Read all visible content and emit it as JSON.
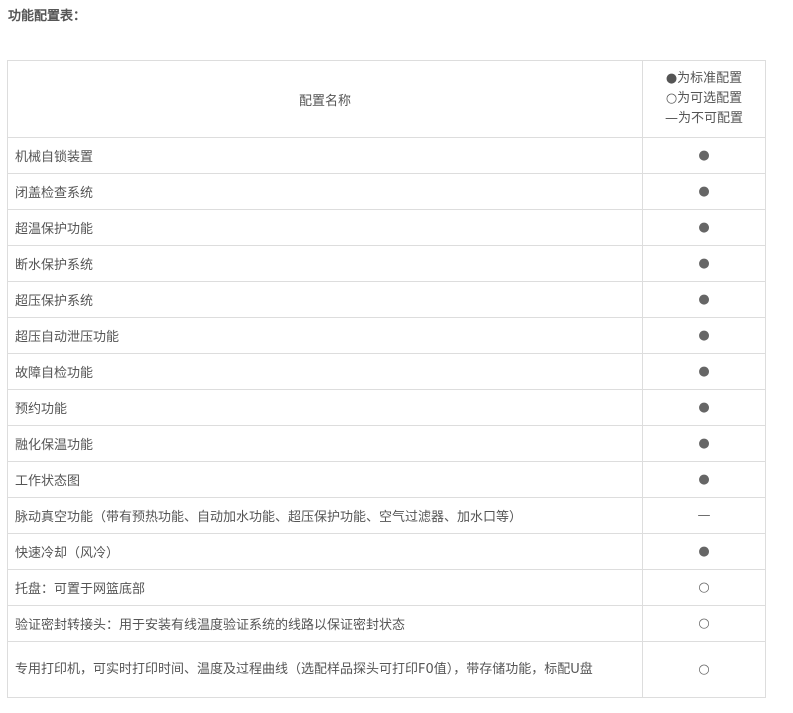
{
  "heading": "功能配置表：",
  "table": {
    "header_name": "配置名称",
    "legend": [
      "●为标准配置",
      "○为可选配置",
      "—为不可配置"
    ],
    "rows": [
      {
        "name": "机械自锁装置",
        "mark": "●"
      },
      {
        "name": "闭盖检查系统",
        "mark": "●"
      },
      {
        "name": "超温保护功能",
        "mark": "●"
      },
      {
        "name": "断水保护系统",
        "mark": "●"
      },
      {
        "name": "超压保护系统",
        "mark": "●"
      },
      {
        "name": "超压自动泄压功能",
        "mark": "●"
      },
      {
        "name": "故障自检功能",
        "mark": "●"
      },
      {
        "name": "预约功能",
        "mark": "●"
      },
      {
        "name": "融化保温功能",
        "mark": "●"
      },
      {
        "name": "工作状态图",
        "mark": "●"
      },
      {
        "name": "脉动真空功能（带有预热功能、自动加水功能、超压保护功能、空气过滤器、加水口等）",
        "mark": "—"
      },
      {
        "name": "快速冷却（风冷）",
        "mark": "●"
      },
      {
        "name": "托盘：可置于网篮底部",
        "mark": "○"
      },
      {
        "name": "验证密封转接头：用于安装有线温度验证系统的线路以保证密封状态",
        "mark": "○"
      },
      {
        "name": "专用打印机，可实时打印时间、温度及过程曲线（选配样品探头可打印F0值），带存储功能，标配U盘",
        "mark": "○"
      }
    ]
  }
}
